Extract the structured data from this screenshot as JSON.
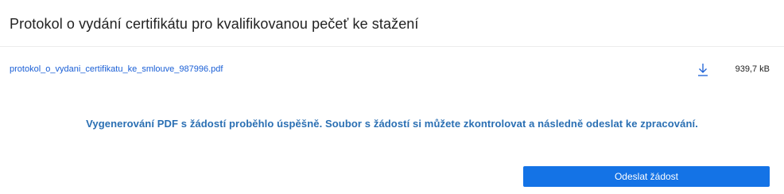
{
  "header": {
    "title": "Protokol o vydání certifikátu pro kvalifikovanou pečeť ke stažení"
  },
  "file": {
    "name": "protokol_o_vydani_certifikatu_ke_smlouve_987996.pdf",
    "size": "939,7 kB",
    "download_icon": "download-arrow-icon"
  },
  "message": {
    "text": "Vygenerování PDF s žádostí proběhlo úspěšně. Soubor s žádostí si můžete zkontrolovat a následně odeslat ke zpracování."
  },
  "actions": {
    "submit_label": "Odeslat žádost"
  },
  "colors": {
    "link": "#1a5fd6",
    "message": "#2a6fb3",
    "button": "#1473e6"
  }
}
